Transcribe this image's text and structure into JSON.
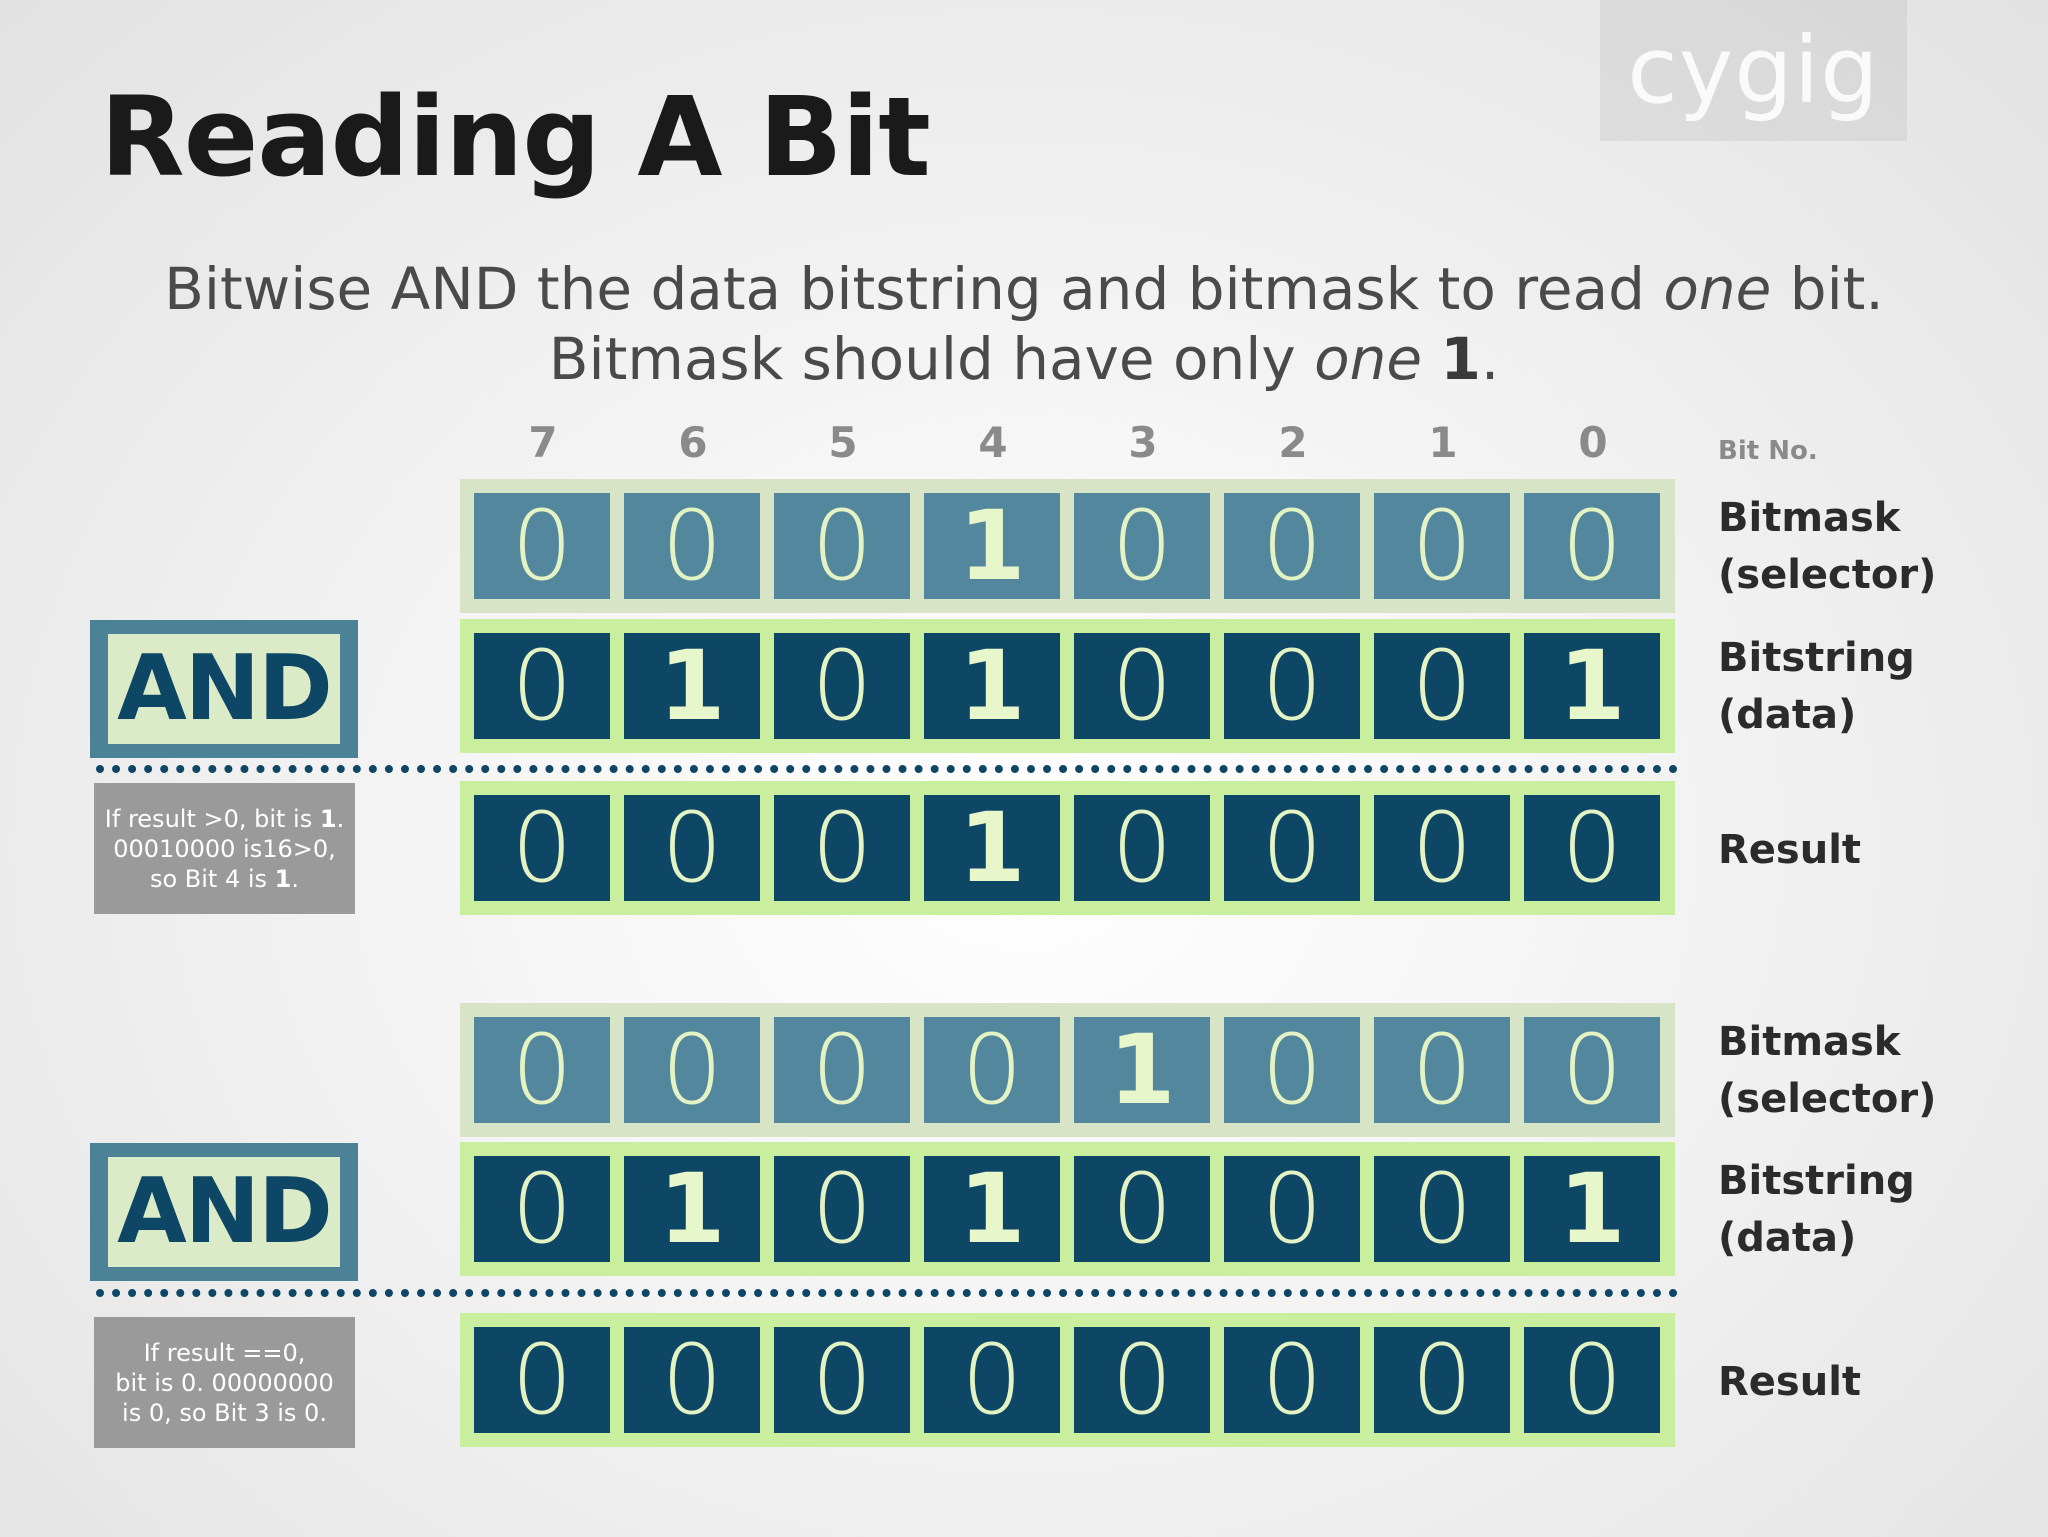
{
  "title": "Reading A Bit",
  "watermark": "cygig",
  "subtitle": {
    "line1_a": "Bitwise AND the data bitstring and bitmask to read ",
    "line1_em": "one",
    "line1_b": " bit.",
    "line2_a": "Bitmask should have only ",
    "line2_em": "one",
    "line2_bold": "1",
    "line2_b": "."
  },
  "bit_numbers": [
    "7",
    "6",
    "5",
    "4",
    "3",
    "2",
    "1",
    "0"
  ],
  "bit_no_label": "Bit No.",
  "operator": "AND",
  "examples": [
    {
      "bitmask": [
        "0",
        "0",
        "0",
        "1",
        "0",
        "0",
        "0",
        "0"
      ],
      "bitstring": [
        "0",
        "1",
        "0",
        "1",
        "0",
        "0",
        "0",
        "1"
      ],
      "result": [
        "0",
        "0",
        "0",
        "1",
        "0",
        "0",
        "0",
        "0"
      ],
      "labels": {
        "bitmask_1": "Bitmask",
        "bitmask_2": "(selector)",
        "bitstring_1": "Bitstring",
        "bitstring_2": "(data)",
        "result": "Result"
      },
      "note": {
        "l1a": "If result >0, bit is ",
        "l1b": "1",
        "l1c": ".",
        "l2": "00010000 is16>0,",
        "l3a": "so Bit 4 is ",
        "l3b": "1",
        "l3c": "."
      }
    },
    {
      "bitmask": [
        "0",
        "0",
        "0",
        "0",
        "1",
        "0",
        "0",
        "0"
      ],
      "bitstring": [
        "0",
        "1",
        "0",
        "1",
        "0",
        "0",
        "0",
        "1"
      ],
      "result": [
        "0",
        "0",
        "0",
        "0",
        "0",
        "0",
        "0",
        "0"
      ],
      "labels": {
        "bitmask_1": "Bitmask",
        "bitmask_2": "(selector)",
        "bitstring_1": "Bitstring",
        "bitstring_2": "(data)",
        "result": "Result"
      },
      "note": {
        "l1": "If result ==0,",
        "l2": "bit is 0. 00000000",
        "l3": "is 0, so Bit 3 is 0."
      }
    }
  ]
}
